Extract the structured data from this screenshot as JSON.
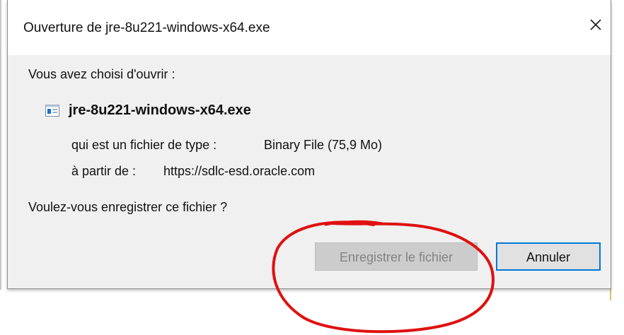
{
  "dialog": {
    "title": "Ouverture de jre-8u221-windows-x64.exe",
    "close_icon": "close-icon",
    "prompt": "Vous avez choisi d'ouvrir :",
    "file": {
      "icon": "executable-file-icon",
      "name": "jre-8u221-windows-x64.exe",
      "type_label": "qui est un fichier de type :",
      "type_value": "Binary File (75,9 Mo)",
      "from_label": "à partir de :",
      "from_value": "https://sdlc-esd.oracle.com"
    },
    "question": "Voulez-vous enregistrer ce fichier ?",
    "buttons": {
      "save_label": "Enregistrer le fichier",
      "save_state": "disabled",
      "cancel_label": "Annuler",
      "cancel_state": "focused"
    }
  },
  "annotation": {
    "shape": "freehand-circle",
    "color": "#e01010",
    "target": "save-button"
  },
  "colors": {
    "accent": "#0078d7",
    "dialog_background": "#f0f0f0",
    "titlebar_background": "#ffffff"
  }
}
